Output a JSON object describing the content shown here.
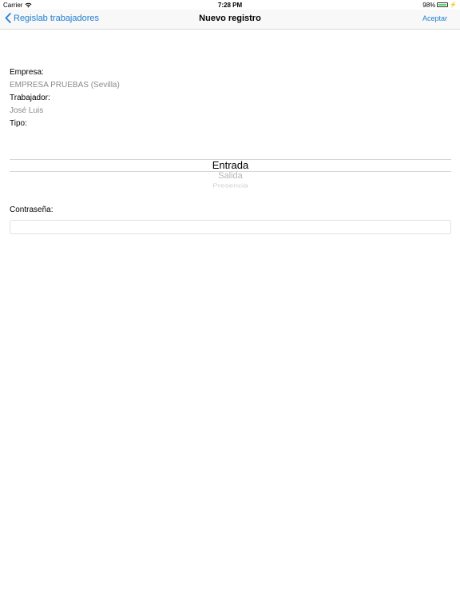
{
  "status_bar": {
    "carrier": "Carrier",
    "time": "7:28 PM",
    "battery": "98%",
    "battery_level": 0.98,
    "battery_color": "#4cd964"
  },
  "nav": {
    "back_label": "Regislab trabajadores",
    "title": "Nuevo registro",
    "action_label": "Aceptar",
    "accent_color": "#1f7fe8"
  },
  "form": {
    "empresa_label": "Empresa:",
    "empresa_value": "EMPRESA PRUEBAS (Sevilla)",
    "trabajador_label": "Trabajador:",
    "trabajador_value": "José Luis",
    "tipo_label": "Tipo:"
  },
  "picker": {
    "options": [
      "Entrada",
      "Salida",
      "Presencia"
    ],
    "selected": "Entrada"
  },
  "password": {
    "label": "Contraseña:",
    "value": "",
    "placeholder": ""
  }
}
